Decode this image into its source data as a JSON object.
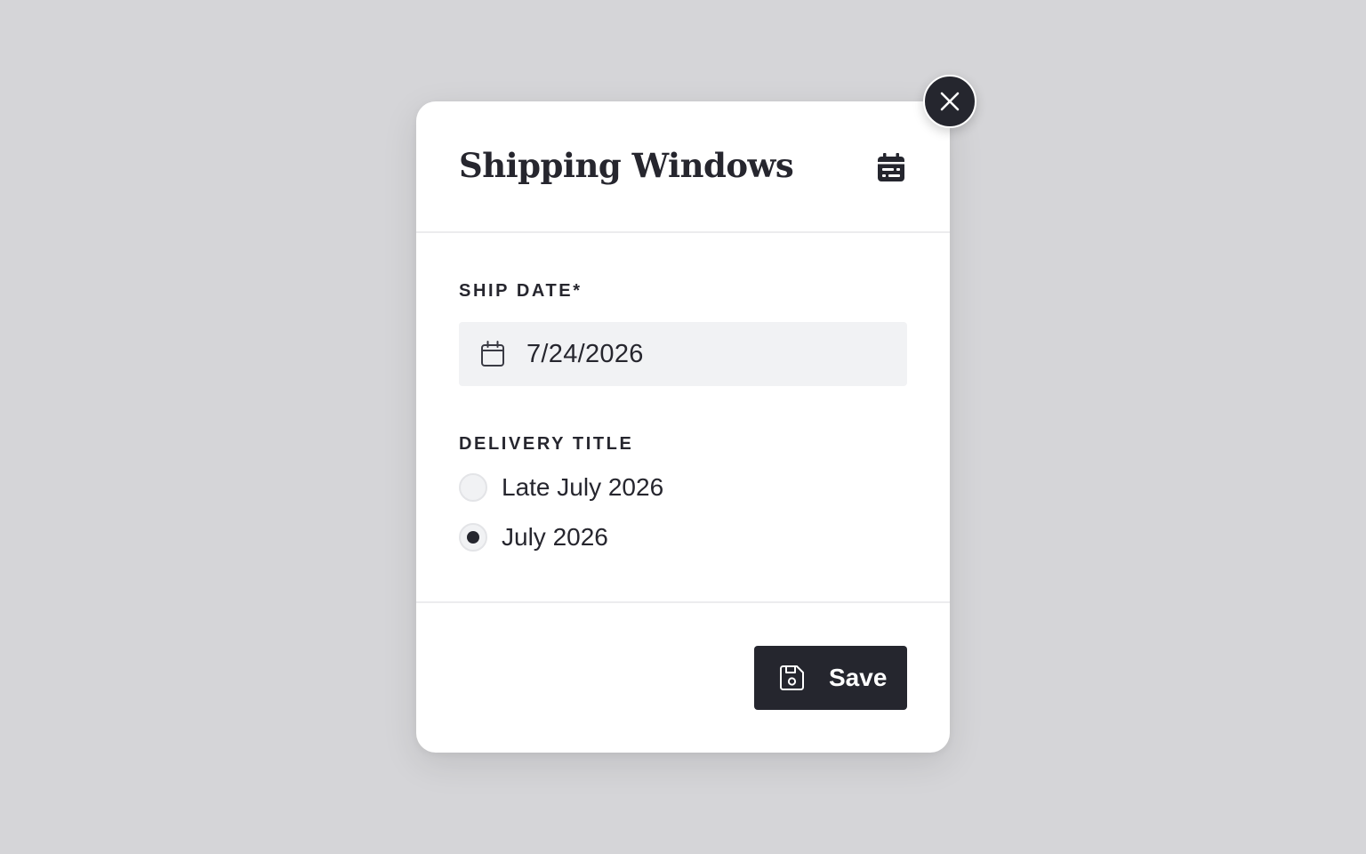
{
  "modal": {
    "title": "Shipping Windows",
    "header_icon": "calendar-event-icon",
    "close_icon": "close-icon"
  },
  "ship_date": {
    "label": "SHIP DATE*",
    "value": "7/24/2026",
    "icon": "calendar-icon"
  },
  "delivery_title": {
    "label": "DELIVERY TITLE",
    "options": [
      {
        "label": "Late July 2026",
        "selected": false
      },
      {
        "label": "July 2026",
        "selected": true
      }
    ]
  },
  "footer": {
    "save_label": "Save",
    "save_icon": "floppy-disk-icon"
  },
  "colors": {
    "backdrop": "#d5d5d8",
    "surface": "#ffffff",
    "ink": "#25262e",
    "input_bg": "#f1f2f4"
  }
}
